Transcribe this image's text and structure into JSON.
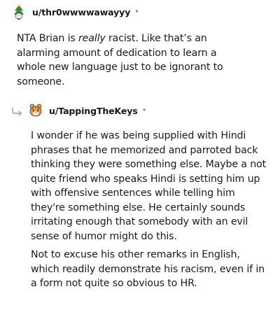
{
  "comments": [
    {
      "username": "u/thr0wwwwawayyy",
      "separator": "•",
      "avatar_icon": "snoo-christmas-tree-avatar-icon",
      "text_before": "NTA Brian is ",
      "text_emphasis": "really",
      "text_after": " racist. Like that’s an alarming amount of dedication to learn a whole new language just to be ignorant to someone."
    },
    {
      "username": "u/TappingTheKeys",
      "separator": "•",
      "avatar_icon": "snoo-tiger-avatar-icon",
      "reply_icon": "reply-arrow-icon",
      "paragraphs": [
        "I wonder if he was being supplied with Hindi phrases that he memorized and parroted back thinking they were something else. Maybe a not quite friend who speaks Hindi is setting him up with offensive sentences while telling him they're something else. He certainly sounds irritating enough that somebody with an evil sense of humor might do this.",
        "Not to excuse his other remarks in English, which readily demonstrate his racism, even if in a form not quite so obvious to HR."
      ]
    }
  ],
  "colors": {
    "text": "#1a1a1b",
    "meta": "#7c7c7c",
    "accent_orange": "#f2a03d",
    "tree_green": "#3a8a3a",
    "reply_arrow": "#a0a0a0"
  }
}
